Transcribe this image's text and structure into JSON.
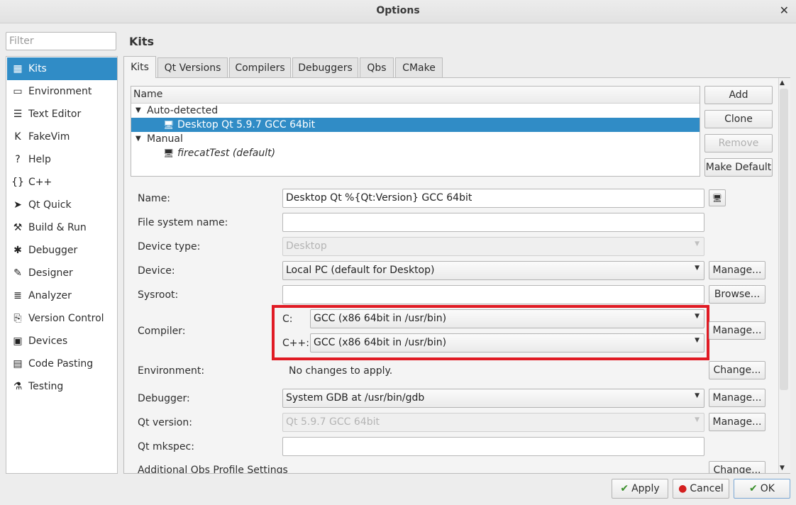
{
  "window": {
    "title": "Options",
    "close_icon": "close-icon"
  },
  "filter": {
    "placeholder": "Filter",
    "value": ""
  },
  "sidebar": {
    "items": [
      {
        "label": "Kits",
        "icon": "kits-icon",
        "glyph": "▦",
        "selected": true
      },
      {
        "label": "Environment",
        "icon": "monitor-icon",
        "glyph": "▭"
      },
      {
        "label": "Text Editor",
        "icon": "text-editor-icon",
        "glyph": "☰"
      },
      {
        "label": "FakeVim",
        "icon": "fakevim-icon",
        "glyph": "K"
      },
      {
        "label": "Help",
        "icon": "help-icon",
        "glyph": "?"
      },
      {
        "label": "C++",
        "icon": "braces-icon",
        "glyph": "{}"
      },
      {
        "label": "Qt Quick",
        "icon": "qt-quick-icon",
        "glyph": "➤"
      },
      {
        "label": "Build & Run",
        "icon": "hammer-icon",
        "glyph": "⚒"
      },
      {
        "label": "Debugger",
        "icon": "bug-icon",
        "glyph": "✱"
      },
      {
        "label": "Designer",
        "icon": "pencil-icon",
        "glyph": "✎"
      },
      {
        "label": "Analyzer",
        "icon": "analyzer-icon",
        "glyph": "≣"
      },
      {
        "label": "Version Control",
        "icon": "version-control-icon",
        "glyph": "⎘"
      },
      {
        "label": "Devices",
        "icon": "devices-icon",
        "glyph": "▣"
      },
      {
        "label": "Code Pasting",
        "icon": "clipboard-icon",
        "glyph": "▤"
      },
      {
        "label": "Testing",
        "icon": "testing-icon",
        "glyph": "⚗"
      }
    ]
  },
  "page": {
    "heading": "Kits",
    "tabs": [
      "Kits",
      "Qt Versions",
      "Compilers",
      "Debuggers",
      "Qbs",
      "CMake"
    ],
    "active_tab": "Kits"
  },
  "tree": {
    "header": "Name",
    "groups": [
      {
        "label": "Auto-detected",
        "expander": "▼",
        "kits": [
          {
            "label": "Desktop Qt 5.9.7 GCC 64bit",
            "selected": true
          }
        ]
      },
      {
        "label": "Manual",
        "expander": "▼",
        "kits": [
          {
            "label": "firecatTest (default)",
            "italic": true
          }
        ]
      }
    ]
  },
  "kit_buttons": {
    "add": "Add",
    "clone": "Clone",
    "remove": "Remove",
    "make_default": "Make Default"
  },
  "form": {
    "name": {
      "label": "Name:",
      "value": "Desktop Qt %{Qt:Version} GCC 64bit"
    },
    "fs_name": {
      "label": "File system name:",
      "value": ""
    },
    "device_type": {
      "label": "Device type:",
      "value": "Desktop"
    },
    "device": {
      "label": "Device:",
      "value": "Local PC (default for Desktop)",
      "button": "Manage..."
    },
    "sysroot": {
      "label": "Sysroot:",
      "value": "",
      "button": "Browse..."
    },
    "compiler": {
      "label": "Compiler:",
      "c_label": "C:",
      "c_value": "GCC (x86 64bit in /usr/bin)",
      "cpp_label": "C++:",
      "cpp_value": "GCC (x86 64bit in /usr/bin)",
      "button": "Manage...",
      "highlight_color": "#e01b24"
    },
    "environment": {
      "label": "Environment:",
      "value": "No changes to apply.",
      "button": "Change..."
    },
    "debugger": {
      "label": "Debugger:",
      "value": "System GDB at /usr/bin/gdb",
      "button": "Manage..."
    },
    "qt_version": {
      "label": "Qt version:",
      "value": "Qt 5.9.7 GCC 64bit",
      "button": "Manage..."
    },
    "qt_mkspec": {
      "label": "Qt mkspec:",
      "value": ""
    },
    "qbs": {
      "label": "Additional Qbs Profile Settings",
      "button": "Change..."
    }
  },
  "footer": {
    "apply": "Apply",
    "cancel": "Cancel",
    "ok": "OK"
  },
  "colors": {
    "selection": "#308cc6",
    "highlight": "#e01b24"
  }
}
